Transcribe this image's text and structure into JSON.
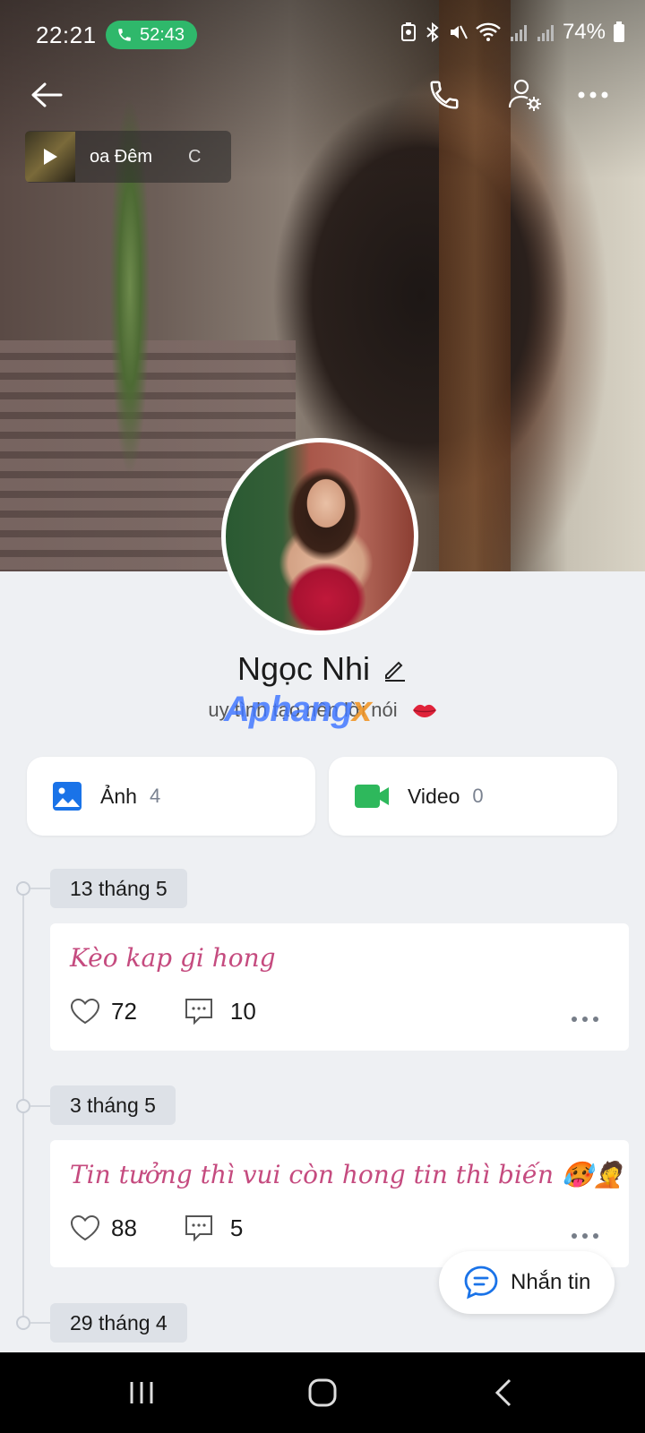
{
  "status_bar": {
    "time": "22:21",
    "call_duration": "52:43",
    "battery": "74%"
  },
  "music": {
    "title_fragment": "oa Đêm",
    "next_fragment": "C"
  },
  "profile": {
    "name": "Ngọc Nhi",
    "bio": "uy tình tạo nên lời nói",
    "watermark": "Aphang",
    "watermark_x": "x"
  },
  "media": [
    {
      "label": "Ảnh",
      "count": "4",
      "icon": "image-icon",
      "color": "#1a73e8"
    },
    {
      "label": "Video",
      "count": "0",
      "icon": "video-camera-icon",
      "color": "#2eb85c"
    }
  ],
  "timeline": [
    {
      "date": "13 tháng 5",
      "text": "Kèo kap gi hong",
      "likes": "72",
      "comments": "10"
    },
    {
      "date": "3 tháng 5",
      "text": "Tin tưởng thì vui còn hong tin thì biến 🥵🤦",
      "likes": "88",
      "comments": "5"
    },
    {
      "date": "29 tháng 4"
    }
  ],
  "message_button": {
    "label": "Nhắn tin"
  },
  "colors": {
    "accent": "#1a73e8",
    "call_green": "#2fb86b",
    "post_text": "#c54b7f"
  }
}
